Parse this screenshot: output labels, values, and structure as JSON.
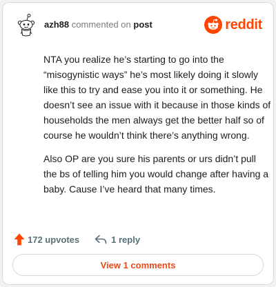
{
  "header": {
    "username": "azh88",
    "commented_on": "commented on",
    "post_link": "post",
    "brand": "reddit"
  },
  "comment": {
    "paragraphs": [
      "NTA you realize he’s starting to go into the “misogynistic ways” he’s most likely doing it slowly like this to try and ease you into it or something. He doesn’t see an issue with it because in those kinds of households the men always get the better half so of course he wouldn’t think there’s anything wrong.",
      "Also OP are you sure his parents or urs didn’t pull the bs of telling him you would change after having a baby. Cause I’ve heard that many times."
    ]
  },
  "actions": {
    "upvotes_label": "172 upvotes",
    "reply_label": "1 reply",
    "view_comments_label": "View 1 comments"
  },
  "colors": {
    "brand_orange": "#ff4500",
    "upvote_red": "#ff4500",
    "muted_text": "#576f76"
  },
  "icons": {
    "avatar": "snoo-avatar-icon",
    "logo": "reddit-logo-icon",
    "upvote": "upvote-arrow-icon",
    "reply": "reply-arrow-icon"
  }
}
